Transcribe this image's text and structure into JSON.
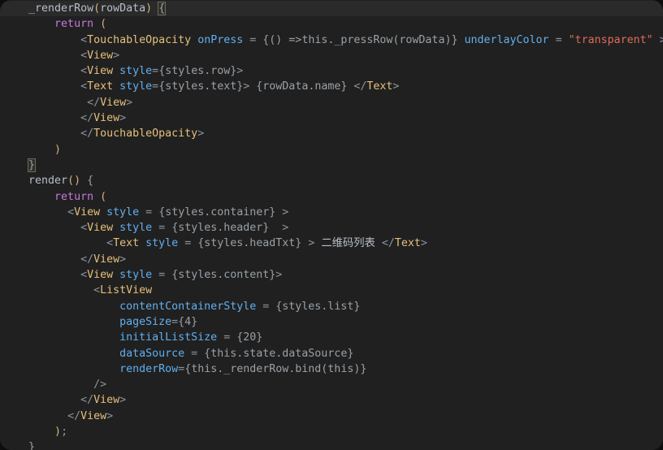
{
  "editor": {
    "language": "jsx",
    "theme": "one-dark",
    "background": "#202020",
    "current_line_background": "#2a2a2a",
    "colors": {
      "tag": "#e5c07b",
      "attribute": "#61afef",
      "keyword": "#c678dd",
      "string": "#e06c5a",
      "plain": "#b8bec8",
      "punctuation": "#8b949e"
    }
  },
  "code": {
    "lines": [
      {
        "id": 1,
        "current": true,
        "text": "    _renderRow(rowData) {",
        "tokens": [
          {
            "t": "    ",
            "c": "tok-plain"
          },
          {
            "t": "_renderRow",
            "c": "tok-plain"
          },
          {
            "t": "(",
            "c": "tok-paren"
          },
          {
            "t": "rowData",
            "c": "tok-plain"
          },
          {
            "t": ")",
            "c": "tok-paren"
          },
          {
            "t": " ",
            "c": "tok-plain"
          },
          {
            "t": "{",
            "c": "tok-brace bracket-box"
          }
        ]
      },
      {
        "id": 2,
        "current": false,
        "text": "        return (",
        "tokens": [
          {
            "t": "        ",
            "c": "tok-plain"
          },
          {
            "t": "return",
            "c": "tok-kw"
          },
          {
            "t": " ",
            "c": "tok-plain"
          },
          {
            "t": "(",
            "c": "tok-paren"
          }
        ]
      },
      {
        "id": 3,
        "current": false,
        "text": "            <TouchableOpacity onPress = {() =>this._pressRow(rowData)} underlayColor = \"transparent\" >",
        "tokens": [
          {
            "t": "            ",
            "c": "tok-plain"
          },
          {
            "t": "<",
            "c": "tok-angle"
          },
          {
            "t": "TouchableOpacity",
            "c": "tok-tag"
          },
          {
            "t": " ",
            "c": "tok-plain"
          },
          {
            "t": "onPress",
            "c": "tok-attr"
          },
          {
            "t": " = ",
            "c": "tok-punct"
          },
          {
            "t": "{() =>",
            "c": "tok-expr"
          },
          {
            "t": "this._pressRow(rowData)}",
            "c": "tok-expr"
          },
          {
            "t": " ",
            "c": "tok-plain"
          },
          {
            "t": "underlayColor",
            "c": "tok-attr"
          },
          {
            "t": " = ",
            "c": "tok-punct"
          },
          {
            "t": "\"transparent\"",
            "c": "tok-str"
          },
          {
            "t": " >",
            "c": "tok-angle"
          }
        ]
      },
      {
        "id": 4,
        "current": false,
        "text": "            <View>",
        "tokens": [
          {
            "t": "            ",
            "c": "tok-plain"
          },
          {
            "t": "<",
            "c": "tok-angle"
          },
          {
            "t": "View",
            "c": "tok-tag"
          },
          {
            "t": ">",
            "c": "tok-angle"
          }
        ]
      },
      {
        "id": 5,
        "current": false,
        "text": "            <View style={styles.row}>",
        "tokens": [
          {
            "t": "            ",
            "c": "tok-plain"
          },
          {
            "t": "<",
            "c": "tok-angle"
          },
          {
            "t": "View",
            "c": "tok-tag"
          },
          {
            "t": " ",
            "c": "tok-plain"
          },
          {
            "t": "style",
            "c": "tok-attr"
          },
          {
            "t": "=",
            "c": "tok-punct"
          },
          {
            "t": "{styles.row}",
            "c": "tok-expr"
          },
          {
            "t": ">",
            "c": "tok-angle"
          }
        ]
      },
      {
        "id": 6,
        "current": false,
        "text": "            <Text style={styles.text}> {rowData.name} </Text>",
        "tokens": [
          {
            "t": "            ",
            "c": "tok-plain"
          },
          {
            "t": "<",
            "c": "tok-angle"
          },
          {
            "t": "Text",
            "c": "tok-tag"
          },
          {
            "t": " ",
            "c": "tok-plain"
          },
          {
            "t": "style",
            "c": "tok-attr"
          },
          {
            "t": "=",
            "c": "tok-punct"
          },
          {
            "t": "{styles.text}",
            "c": "tok-expr"
          },
          {
            "t": "> ",
            "c": "tok-angle"
          },
          {
            "t": "{rowData.name}",
            "c": "tok-expr"
          },
          {
            "t": " ",
            "c": "tok-plain"
          },
          {
            "t": "</",
            "c": "tok-angle"
          },
          {
            "t": "Text",
            "c": "tok-tag"
          },
          {
            "t": ">",
            "c": "tok-angle"
          }
        ]
      },
      {
        "id": 7,
        "current": false,
        "text": "             </View>",
        "tokens": [
          {
            "t": "             ",
            "c": "tok-plain"
          },
          {
            "t": "</",
            "c": "tok-angle"
          },
          {
            "t": "View",
            "c": "tok-tag"
          },
          {
            "t": ">",
            "c": "tok-angle"
          }
        ]
      },
      {
        "id": 8,
        "current": false,
        "text": "            </View>",
        "tokens": [
          {
            "t": "            ",
            "c": "tok-plain"
          },
          {
            "t": "</",
            "c": "tok-angle"
          },
          {
            "t": "View",
            "c": "tok-tag"
          },
          {
            "t": ">",
            "c": "tok-angle"
          }
        ]
      },
      {
        "id": 9,
        "current": false,
        "text": "            </TouchableOpacity>",
        "tokens": [
          {
            "t": "            ",
            "c": "tok-plain"
          },
          {
            "t": "</",
            "c": "tok-angle"
          },
          {
            "t": "TouchableOpacity",
            "c": "tok-tag"
          },
          {
            "t": ">",
            "c": "tok-angle"
          }
        ]
      },
      {
        "id": 10,
        "current": false,
        "text": "        )",
        "tokens": [
          {
            "t": "        ",
            "c": "tok-plain"
          },
          {
            "t": ")",
            "c": "tok-paren"
          }
        ]
      },
      {
        "id": 11,
        "current": false,
        "text": "    }",
        "tokens": [
          {
            "t": "    ",
            "c": "tok-plain"
          },
          {
            "t": "}",
            "c": "tok-brace bracket-box"
          }
        ]
      },
      {
        "id": 12,
        "current": false,
        "text": "    render() {",
        "tokens": [
          {
            "t": "    ",
            "c": "tok-plain"
          },
          {
            "t": "render",
            "c": "tok-plain"
          },
          {
            "t": "(",
            "c": "tok-paren"
          },
          {
            "t": ")",
            "c": "tok-paren"
          },
          {
            "t": " ",
            "c": "tok-plain"
          },
          {
            "t": "{",
            "c": "tok-brace"
          }
        ]
      },
      {
        "id": 13,
        "current": false,
        "text": "        return (",
        "tokens": [
          {
            "t": "        ",
            "c": "tok-plain"
          },
          {
            "t": "return",
            "c": "tok-kw"
          },
          {
            "t": " ",
            "c": "tok-plain"
          },
          {
            "t": "(",
            "c": "tok-paren"
          }
        ]
      },
      {
        "id": 14,
        "current": false,
        "text": "          <View style = {styles.container} >",
        "tokens": [
          {
            "t": "          ",
            "c": "tok-plain"
          },
          {
            "t": "<",
            "c": "tok-angle"
          },
          {
            "t": "View",
            "c": "tok-tag"
          },
          {
            "t": " ",
            "c": "tok-plain"
          },
          {
            "t": "style",
            "c": "tok-attr"
          },
          {
            "t": " = ",
            "c": "tok-punct"
          },
          {
            "t": "{styles.container}",
            "c": "tok-expr"
          },
          {
            "t": " >",
            "c": "tok-angle"
          }
        ]
      },
      {
        "id": 15,
        "current": false,
        "text": "            <View style = {styles.header}  >",
        "tokens": [
          {
            "t": "            ",
            "c": "tok-plain"
          },
          {
            "t": "<",
            "c": "tok-angle"
          },
          {
            "t": "View",
            "c": "tok-tag"
          },
          {
            "t": " ",
            "c": "tok-plain"
          },
          {
            "t": "style",
            "c": "tok-attr"
          },
          {
            "t": " = ",
            "c": "tok-punct"
          },
          {
            "t": "{styles.header}",
            "c": "tok-expr"
          },
          {
            "t": "  >",
            "c": "tok-angle"
          }
        ]
      },
      {
        "id": 16,
        "current": false,
        "text": "                <Text style = {styles.headTxt} > 二维码列表 </Text>",
        "tokens": [
          {
            "t": "                ",
            "c": "tok-plain"
          },
          {
            "t": "<",
            "c": "tok-angle"
          },
          {
            "t": "Text",
            "c": "tok-tag"
          },
          {
            "t": " ",
            "c": "tok-plain"
          },
          {
            "t": "style",
            "c": "tok-attr"
          },
          {
            "t": " = ",
            "c": "tok-punct"
          },
          {
            "t": "{styles.headTxt}",
            "c": "tok-expr"
          },
          {
            "t": " > ",
            "c": "tok-angle"
          },
          {
            "t": "二维码列表",
            "c": "tok-cjk"
          },
          {
            "t": " ",
            "c": "tok-plain"
          },
          {
            "t": "</",
            "c": "tok-angle"
          },
          {
            "t": "Text",
            "c": "tok-tag"
          },
          {
            "t": ">",
            "c": "tok-angle"
          }
        ]
      },
      {
        "id": 17,
        "current": false,
        "text": "            </View>",
        "tokens": [
          {
            "t": "            ",
            "c": "tok-plain"
          },
          {
            "t": "</",
            "c": "tok-angle"
          },
          {
            "t": "View",
            "c": "tok-tag"
          },
          {
            "t": ">",
            "c": "tok-angle"
          }
        ]
      },
      {
        "id": 18,
        "current": false,
        "text": "            <View style = {styles.content}>",
        "tokens": [
          {
            "t": "            ",
            "c": "tok-plain"
          },
          {
            "t": "<",
            "c": "tok-angle"
          },
          {
            "t": "View",
            "c": "tok-tag"
          },
          {
            "t": " ",
            "c": "tok-plain"
          },
          {
            "t": "style",
            "c": "tok-attr"
          },
          {
            "t": " = ",
            "c": "tok-punct"
          },
          {
            "t": "{styles.content}",
            "c": "tok-expr"
          },
          {
            "t": ">",
            "c": "tok-angle"
          }
        ]
      },
      {
        "id": 19,
        "current": false,
        "text": "              <ListView",
        "tokens": [
          {
            "t": "              ",
            "c": "tok-plain"
          },
          {
            "t": "<",
            "c": "tok-angle"
          },
          {
            "t": "ListView",
            "c": "tok-tag"
          }
        ]
      },
      {
        "id": 20,
        "current": false,
        "text": "                  contentContainerStyle = {styles.list}",
        "tokens": [
          {
            "t": "                  ",
            "c": "tok-plain"
          },
          {
            "t": "contentContainerStyle",
            "c": "tok-attr"
          },
          {
            "t": " = ",
            "c": "tok-punct"
          },
          {
            "t": "{styles.list}",
            "c": "tok-expr"
          }
        ]
      },
      {
        "id": 21,
        "current": false,
        "text": "                  pageSize={4}",
        "tokens": [
          {
            "t": "                  ",
            "c": "tok-plain"
          },
          {
            "t": "pageSize",
            "c": "tok-attr"
          },
          {
            "t": "=",
            "c": "tok-punct"
          },
          {
            "t": "{4}",
            "c": "tok-expr"
          }
        ]
      },
      {
        "id": 22,
        "current": false,
        "text": "                  initialListSize = {20}",
        "tokens": [
          {
            "t": "                  ",
            "c": "tok-plain"
          },
          {
            "t": "initialListSize",
            "c": "tok-attr"
          },
          {
            "t": " = ",
            "c": "tok-punct"
          },
          {
            "t": "{20}",
            "c": "tok-expr"
          }
        ]
      },
      {
        "id": 23,
        "current": false,
        "text": "                  dataSource = {this.state.dataSource}",
        "tokens": [
          {
            "t": "                  ",
            "c": "tok-plain"
          },
          {
            "t": "dataSource",
            "c": "tok-attr"
          },
          {
            "t": " = ",
            "c": "tok-punct"
          },
          {
            "t": "{this.state.dataSource}",
            "c": "tok-expr"
          }
        ]
      },
      {
        "id": 24,
        "current": false,
        "text": "                  renderRow={this._renderRow.bind(this)}",
        "tokens": [
          {
            "t": "                  ",
            "c": "tok-plain"
          },
          {
            "t": "renderRow",
            "c": "tok-attr"
          },
          {
            "t": "=",
            "c": "tok-punct"
          },
          {
            "t": "{this._renderRow.bind(this)}",
            "c": "tok-expr"
          }
        ]
      },
      {
        "id": 25,
        "current": false,
        "text": "              />",
        "tokens": [
          {
            "t": "              ",
            "c": "tok-plain"
          },
          {
            "t": "/>",
            "c": "tok-angle"
          }
        ]
      },
      {
        "id": 26,
        "current": false,
        "text": "            </View>",
        "tokens": [
          {
            "t": "            ",
            "c": "tok-plain"
          },
          {
            "t": "</",
            "c": "tok-angle"
          },
          {
            "t": "View",
            "c": "tok-tag"
          },
          {
            "t": ">",
            "c": "tok-angle"
          }
        ]
      },
      {
        "id": 27,
        "current": false,
        "text": "          </View>",
        "tokens": [
          {
            "t": "          ",
            "c": "tok-plain"
          },
          {
            "t": "</",
            "c": "tok-angle"
          },
          {
            "t": "View",
            "c": "tok-tag"
          },
          {
            "t": ">",
            "c": "tok-angle"
          }
        ]
      },
      {
        "id": 28,
        "current": false,
        "text": "        );",
        "tokens": [
          {
            "t": "        ",
            "c": "tok-plain"
          },
          {
            "t": ")",
            "c": "tok-paren"
          },
          {
            "t": ";",
            "c": "tok-punct"
          }
        ]
      },
      {
        "id": 29,
        "current": false,
        "text": "    }",
        "tokens": [
          {
            "t": "    ",
            "c": "tok-plain"
          },
          {
            "t": "}",
            "c": "tok-brace"
          }
        ]
      }
    ]
  }
}
